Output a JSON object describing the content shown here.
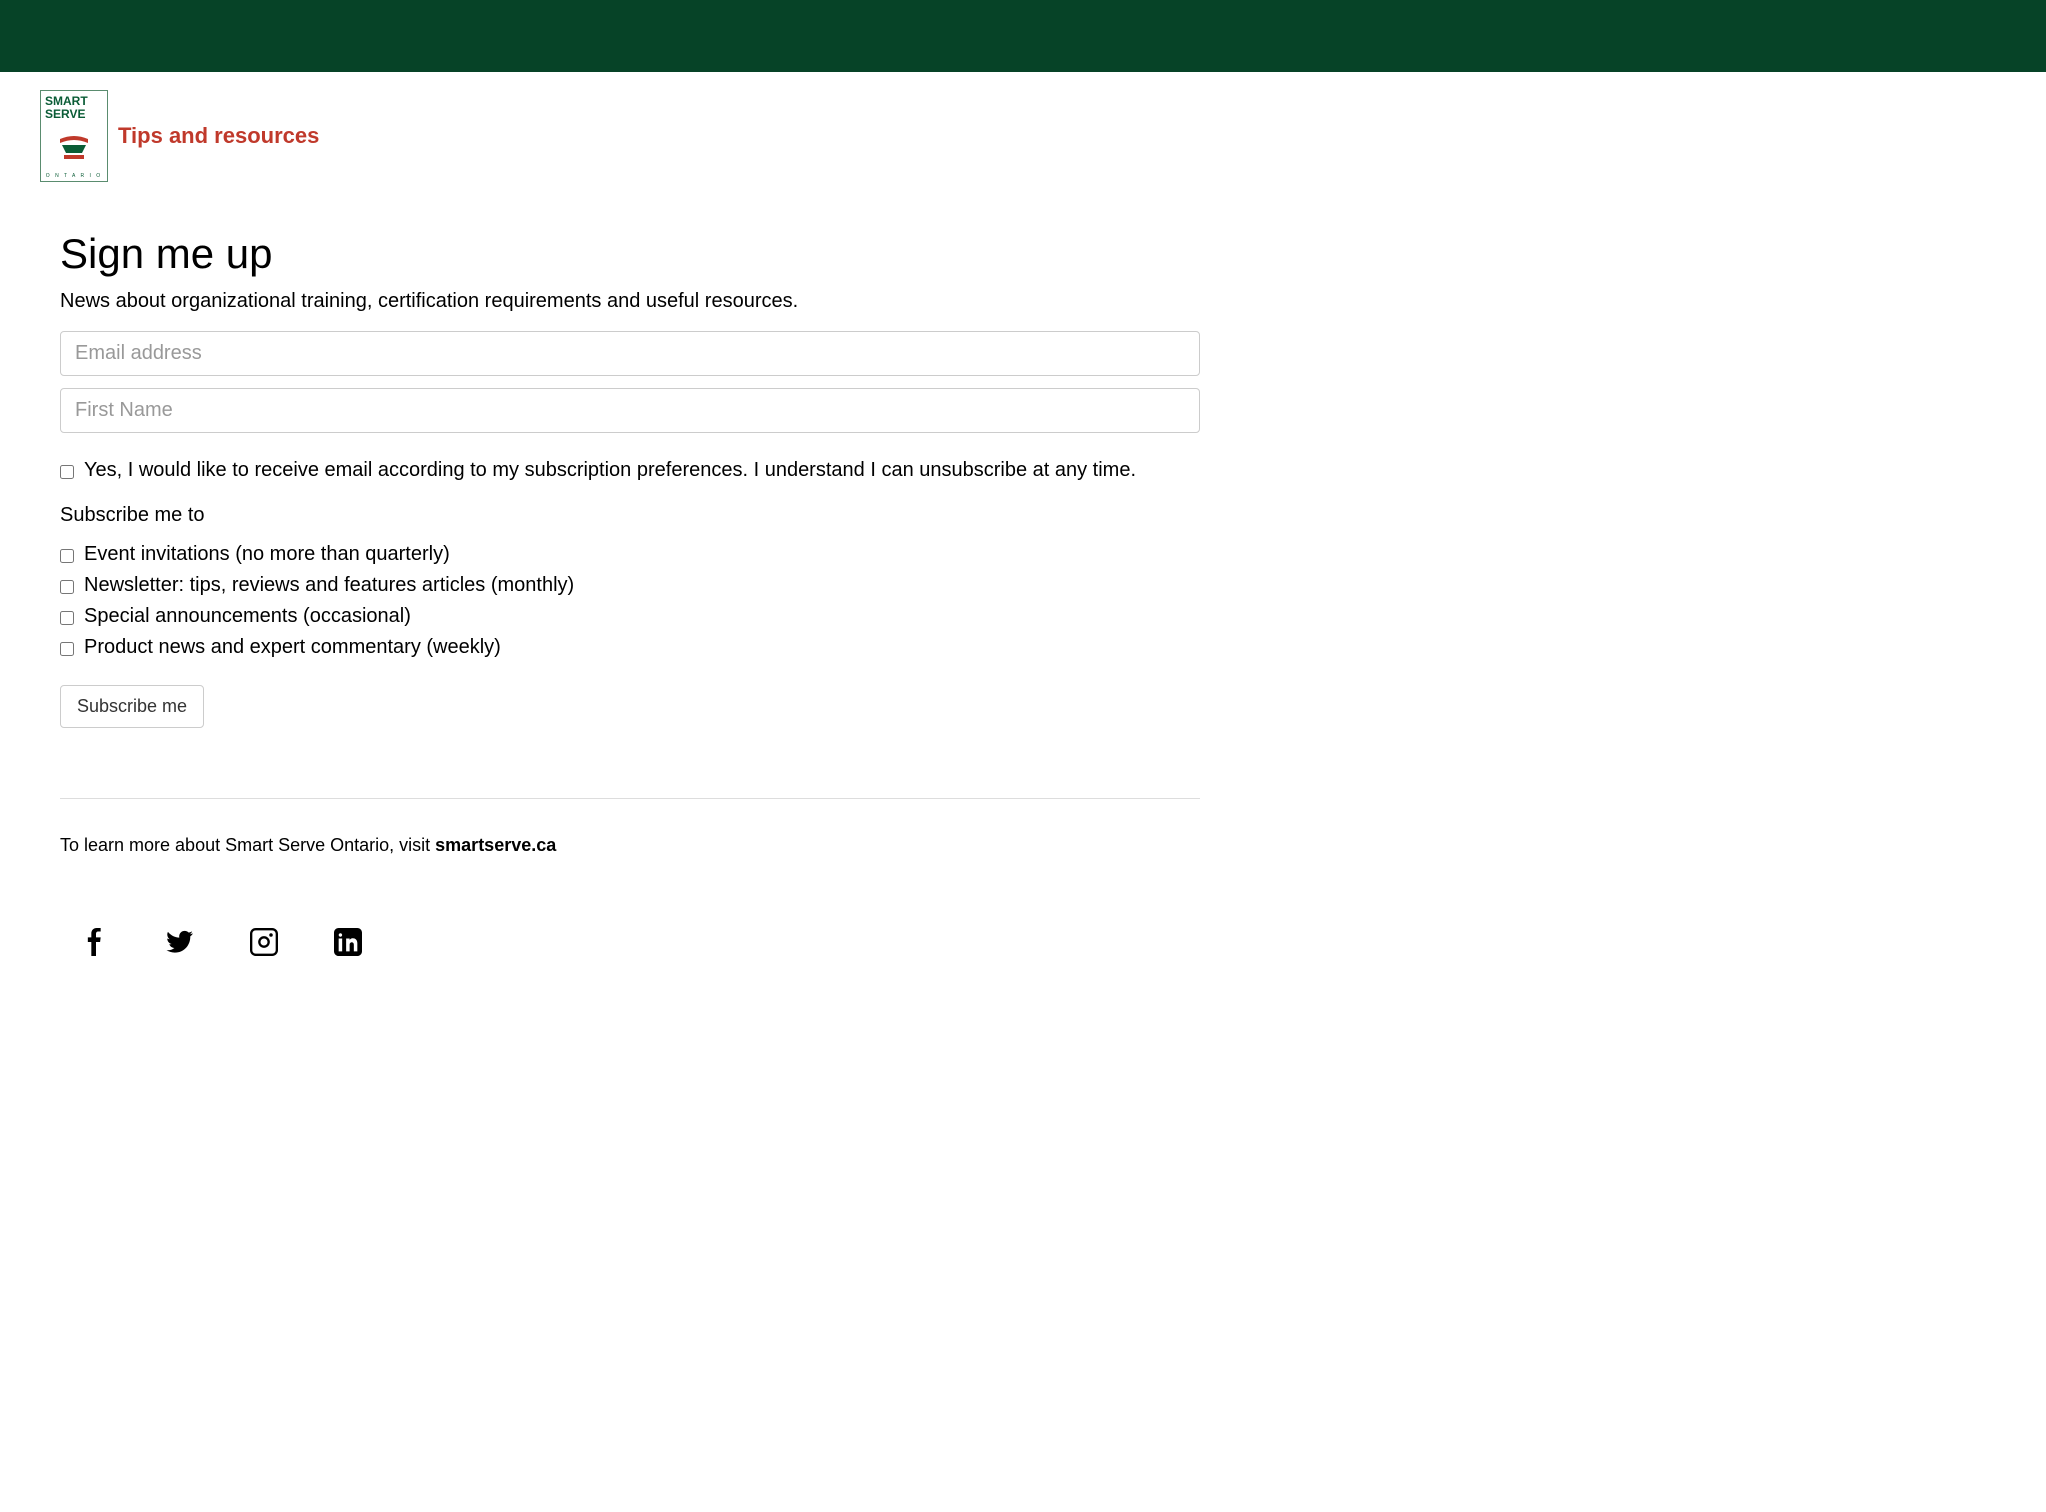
{
  "logo": {
    "line1": "SMART",
    "line2": "SERVE",
    "bottom": "O N T A R I O"
  },
  "tagline": "Tips and resources",
  "heading": "Sign me up",
  "subtitle": "News about organizational training, certification requirements and useful resources.",
  "form": {
    "email_placeholder": "Email address",
    "firstname_placeholder": "First Name",
    "consent_label": "Yes, I would like to receive email according to my subscription preferences. I understand I can unsubscribe at any time.",
    "section_label": "Subscribe me to",
    "options": [
      "Event invitations (no more than quarterly)",
      "Newsletter: tips, reviews and features articles (monthly)",
      "Special announcements (occasional)",
      "Product news and expert commentary (weekly)"
    ],
    "submit_label": "Subscribe me"
  },
  "footer": {
    "text_prefix": "To learn more about Smart Serve Ontario, visit ",
    "link_text": "smartserve.ca"
  }
}
